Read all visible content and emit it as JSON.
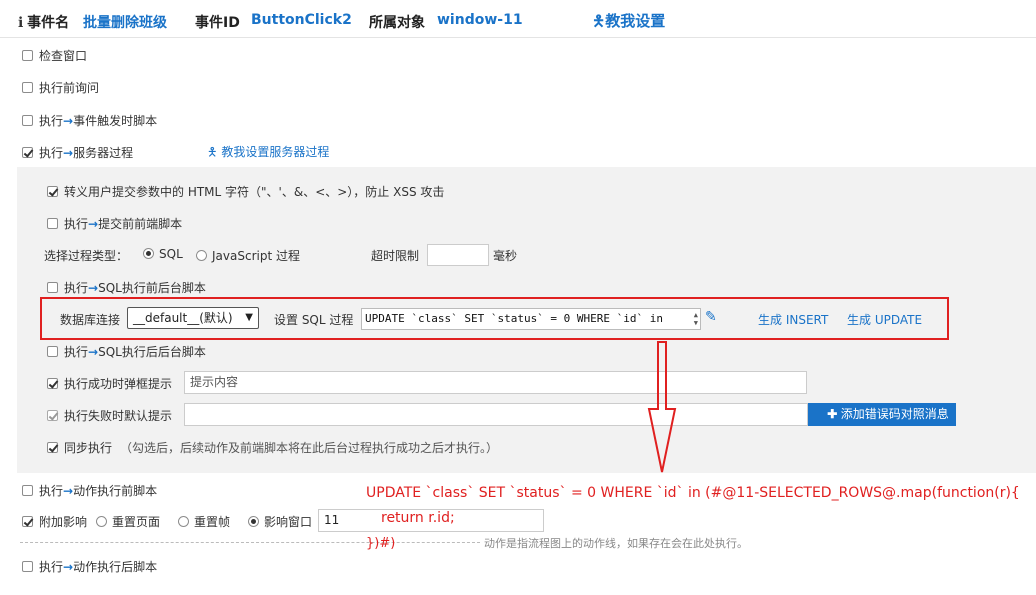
{
  "header": {
    "event_name_label": "事件名",
    "event_name_value": "批量删除班级",
    "event_id_label": "事件ID",
    "event_id_value": "ButtonClick2",
    "owner_label": "所属对象",
    "owner_value": "window-11",
    "help_link": "教我设置"
  },
  "top_options": {
    "check_window": "检查窗口",
    "ask_before": "执行前询问",
    "exec": "执行",
    "event_script": "事件触发时脚本",
    "server_proc": "服务器过程",
    "server_help": "教我设置服务器过程"
  },
  "panel": {
    "escape_html": "转义用户提交参数中的 HTML 字符（\"、'、&、<、>），防止 XSS 攻击",
    "exec": "执行",
    "pre_submit_script": "提交前前端脚本",
    "proc_type_label": "选择过程类型：",
    "proc_sql": "SQL",
    "proc_js": "JavaScript 过程",
    "timeout_label": "超时限制",
    "timeout_value": "",
    "timeout_unit": "毫秒",
    "sql_before_script": "SQL执行前后台脚本",
    "db_label": "数据库连接",
    "db_value": "__default__(默认)",
    "sql_label": "设置 SQL 过程",
    "sql_value": "UPDATE `class` SET `status` = 0 WHERE `id` in",
    "gen_insert": "生成 INSERT",
    "gen_update": "生成 UPDATE",
    "sql_after_script": "SQL执行后后台脚本",
    "success_popup": "执行成功时弹框提示",
    "success_placeholder": "提示内容",
    "fail_default": "执行失败时默认提示",
    "add_error_btn": "添加错误码对照消息",
    "sync_exec": "同步执行",
    "sync_note": "（勾选后，后续动作及前端脚本将在此后台过程执行成功之后才执行。）"
  },
  "bottom_options": {
    "exec": "执行",
    "pre_action_script": "动作执行前脚本",
    "extra_effect": "附加影响",
    "reset_page": "重置页面",
    "reset_frame": "重置帧",
    "affect_window": "影响窗口",
    "affect_window_value": "11",
    "dash_note": "动作是指流程图上的动作线，如果存在会在此处执行。",
    "post_action_script": "动作执行后脚本"
  },
  "annotation": {
    "line1": "UPDATE `class` SET `status` = 0 WHERE `id` in (#@11-SELECTED_ROWS@.map(function(r){",
    "line2": "return r.id;",
    "line3": "})#)"
  },
  "colors": {
    "accent": "#1a73c8",
    "annotation_red": "#e02020",
    "panel_bg": "#f2f2f2"
  }
}
